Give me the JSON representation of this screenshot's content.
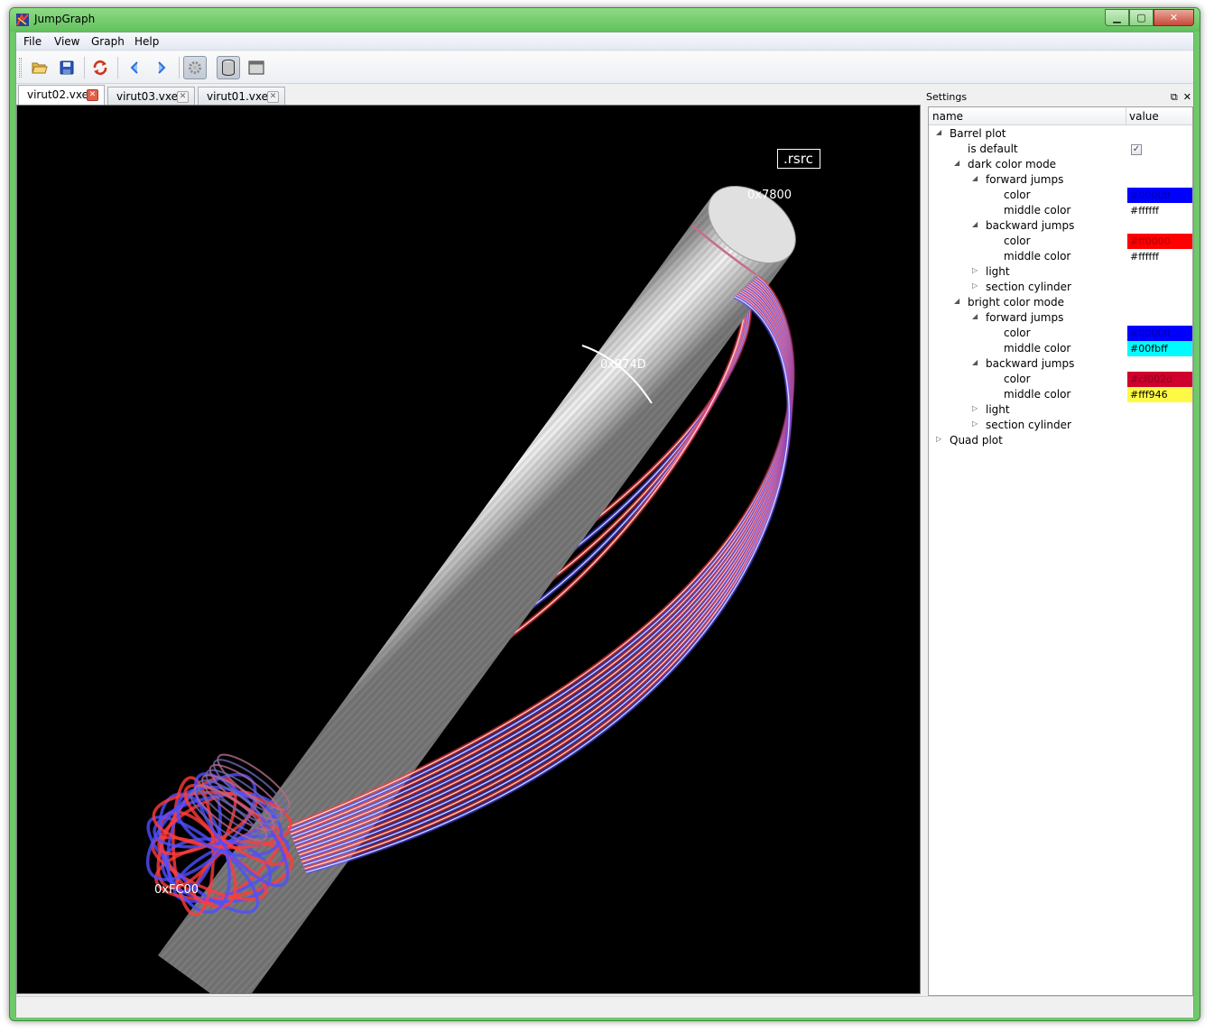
{
  "window": {
    "title": "JumpGraph",
    "buttons": {
      "minimize": "▁",
      "maximize": "▢",
      "close": "✕"
    }
  },
  "menu": [
    "File",
    "View",
    "Graph",
    "Help"
  ],
  "toolbar": {
    "icons": [
      "open-folder-icon",
      "save-disk-icon",
      "reload-icon",
      "back-arrow-icon",
      "forward-arrow-icon",
      "settings-gear-icon",
      "barrel-plot-icon",
      "quad-plot-icon"
    ]
  },
  "tabs": [
    {
      "label": "virut02.vxe",
      "active": true
    },
    {
      "label": "virut03.vxe",
      "active": false
    },
    {
      "label": "virut01.vxe",
      "active": false
    }
  ],
  "viewport": {
    "section_label": ".rsrc",
    "address_top": "0x7800",
    "address_mid": "0x974D",
    "address_bottom": "0xFC00"
  },
  "settings": {
    "title": "Settings",
    "columns": {
      "name": "name",
      "value": "value"
    },
    "rows": [
      {
        "label": "Barrel plot",
        "depth": 0,
        "arrow": "◢"
      },
      {
        "label": "is default",
        "depth": 1,
        "arrow": "",
        "checkbox": true
      },
      {
        "label": "dark color mode",
        "depth": 1,
        "arrow": "◢"
      },
      {
        "label": "forward jumps",
        "depth": 2,
        "arrow": "◢"
      },
      {
        "label": "color",
        "depth": 3,
        "arrow": "",
        "value": "#0000ff",
        "swatch": "#0000ff",
        "valueColor": "#0000aa"
      },
      {
        "label": "middle color",
        "depth": 3,
        "arrow": "",
        "value": "#ffffff",
        "swatch": "#ffffff",
        "valueColor": "#000000"
      },
      {
        "label": "backward jumps",
        "depth": 2,
        "arrow": "◢"
      },
      {
        "label": "color",
        "depth": 3,
        "arrow": "",
        "value": "#ff0000",
        "swatch": "#ff0000",
        "valueColor": "#aa0000"
      },
      {
        "label": "middle color",
        "depth": 3,
        "arrow": "",
        "value": "#ffffff",
        "swatch": "#ffffff",
        "valueColor": "#000000"
      },
      {
        "label": "light",
        "depth": 2,
        "arrow": "▷"
      },
      {
        "label": "section cylinder",
        "depth": 2,
        "arrow": "▷"
      },
      {
        "label": "bright color mode",
        "depth": 1,
        "arrow": "◢"
      },
      {
        "label": "forward jumps",
        "depth": 2,
        "arrow": "◢"
      },
      {
        "label": "color",
        "depth": 3,
        "arrow": "",
        "value": "#0000ff",
        "swatch": "#0000ff",
        "valueColor": "#0000aa"
      },
      {
        "label": "middle color",
        "depth": 3,
        "arrow": "",
        "value": "#00fbff",
        "swatch": "#00fbff",
        "valueColor": "#000000"
      },
      {
        "label": "backward jumps",
        "depth": 2,
        "arrow": "◢"
      },
      {
        "label": "color",
        "depth": 3,
        "arrow": "",
        "value": "#cf002d",
        "swatch": "#cf002d",
        "valueColor": "#8a001e"
      },
      {
        "label": "middle color",
        "depth": 3,
        "arrow": "",
        "value": "#fff946",
        "swatch": "#fff946",
        "valueColor": "#000000"
      },
      {
        "label": "light",
        "depth": 2,
        "arrow": "▷"
      },
      {
        "label": "section cylinder",
        "depth": 2,
        "arrow": "▷"
      },
      {
        "label": "Quad plot",
        "depth": 0,
        "arrow": "▷"
      }
    ]
  }
}
